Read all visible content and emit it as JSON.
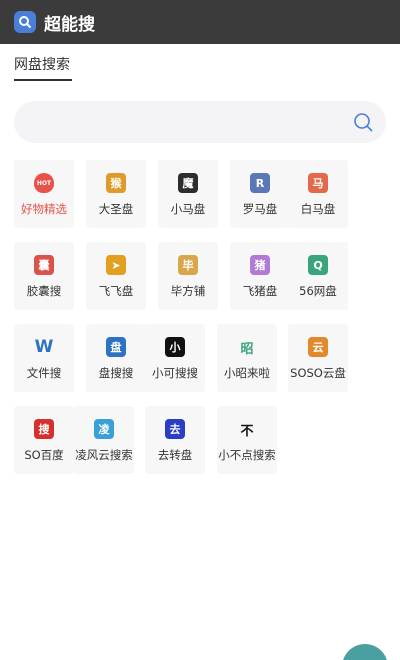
{
  "header": {
    "title": "超能搜"
  },
  "tab": {
    "label": "网盘搜索"
  },
  "search": {
    "placeholder": ""
  },
  "tiles": [
    {
      "label": "好物精选",
      "icon": "fire-icon",
      "icon_color": "#e8524a",
      "glyph": "HOT",
      "red": true
    },
    {
      "label": "大圣盘",
      "icon": "monkey-icon",
      "icon_color": "#e09a2b",
      "glyph": "猴"
    },
    {
      "label": "小马盘",
      "icon": "devil-mask-icon",
      "icon_color": "#2d2d2d",
      "glyph": "魔"
    },
    {
      "label": "罗马盘",
      "icon": "letter-r-icon",
      "icon_color": "#5a77b8",
      "glyph": "R"
    },
    {
      "label": "白马盘",
      "icon": "horse-icon",
      "icon_color": "#e26a4a",
      "glyph": "马"
    },
    {
      "label": "胶囊搜",
      "icon": "capsule-icon",
      "icon_color": "#d8544d",
      "glyph": "囊"
    },
    {
      "label": "飞飞盘",
      "icon": "paper-plane-icon",
      "icon_color": "#e1a020",
      "glyph": "➤"
    },
    {
      "label": "毕方铺",
      "icon": "bifang-logo-icon",
      "icon_color": "#d9a64a",
      "glyph": "毕"
    },
    {
      "label": "飞猪盘",
      "icon": "pig-icon",
      "icon_color": "#b07ad6",
      "glyph": "猪"
    },
    {
      "label": "56网盘",
      "icon": "letter-q-icon",
      "icon_color": "#3aa57a",
      "glyph": "Q"
    },
    {
      "label": "文件搜",
      "icon": "letter-w-icon",
      "icon_color": "#ffffff",
      "glyph": "W"
    },
    {
      "label": "盘搜搜",
      "icon": "pan-square-icon",
      "icon_color": "#2e72c4",
      "glyph": "盘"
    },
    {
      "label": "小可搜搜",
      "icon": "xiao-square-icon",
      "icon_color": "#111111",
      "glyph": "小"
    },
    {
      "label": "小昭来啦",
      "icon": "zhao-icon",
      "icon_color": "#ffffff",
      "glyph": "昭"
    },
    {
      "label": "SOSO云盘",
      "icon": "yun-square-icon",
      "icon_color": "#e08a2b",
      "glyph": "云"
    },
    {
      "label": "SO百度",
      "icon": "sou-square-icon",
      "icon_color": "#d6302a",
      "glyph": "搜"
    },
    {
      "label": "凌风云搜索",
      "icon": "ling-square-icon",
      "icon_color": "#3aa0d8",
      "glyph": "凌"
    },
    {
      "label": "去转盘",
      "icon": "qu-square-icon",
      "icon_color": "#2a3ec4",
      "glyph": "去"
    },
    {
      "label": "小不点搜索",
      "icon": "bu-icon",
      "icon_color": "#ffffff",
      "glyph": "不"
    }
  ]
}
